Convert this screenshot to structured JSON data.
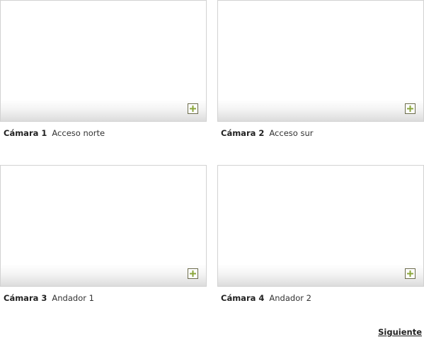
{
  "cameras": [
    {
      "name": "Cámara 1",
      "description": "Acceso norte",
      "icon": "plus-icon"
    },
    {
      "name": "Cámara 2",
      "description": "Acceso sur",
      "icon": "plus-icon"
    },
    {
      "name": "Cámara 3",
      "description": "Andador 1",
      "icon": "plus-icon"
    },
    {
      "name": "Cámara 4",
      "description": "Andador 2",
      "icon": "plus-icon"
    }
  ],
  "pagination": {
    "next_label": "Siguiente"
  },
  "colors": {
    "plus_icon": "#8aa63a",
    "plus_border": "#6b6b4a",
    "text": "#222222"
  }
}
